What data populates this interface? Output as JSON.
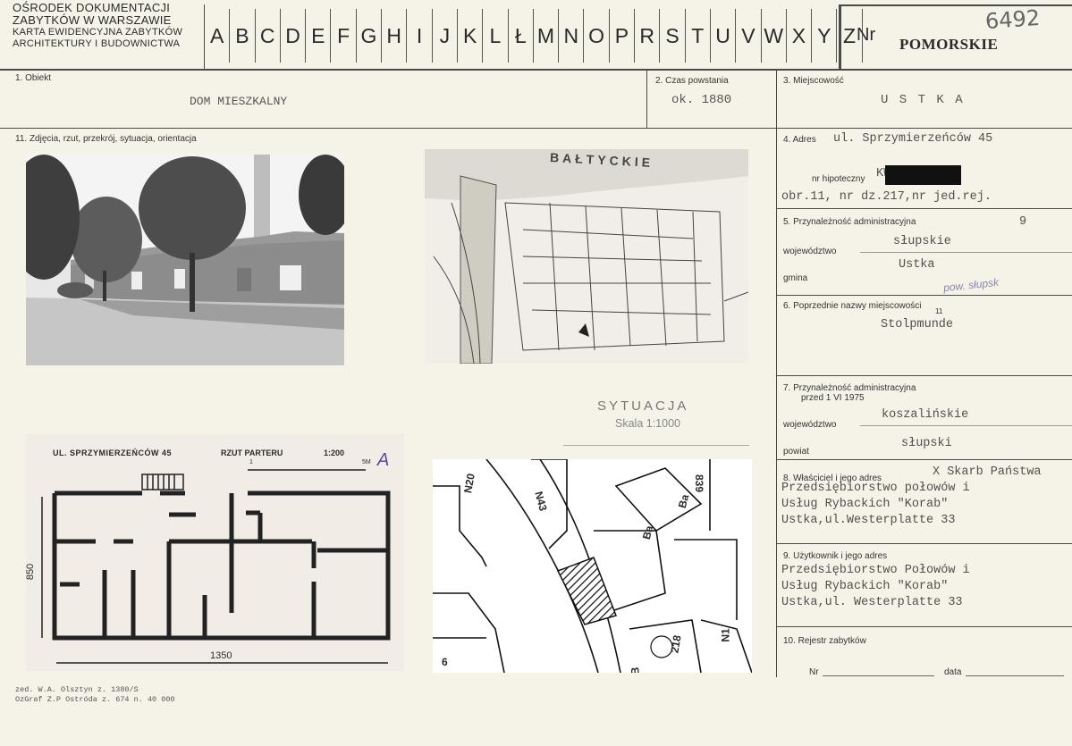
{
  "header": {
    "institution_line1": "Ośrodek Dokumentacji",
    "institution_line2": "Zabytków w Warszawie",
    "institution_line3": "Karta ewidencyjna zabytków",
    "institution_line4": "architektury i budownictwa",
    "letters": [
      "A",
      "B",
      "C",
      "D",
      "E",
      "F",
      "G",
      "H",
      "I",
      "J",
      "K",
      "L",
      "Ł",
      "M",
      "N",
      "O",
      "P",
      "R",
      "S",
      "T",
      "U",
      "V",
      "W",
      "X",
      "Y",
      "Z"
    ],
    "nr_label": "Nr",
    "region": "POMORSKIE",
    "handwritten_number": "6492"
  },
  "fields": {
    "obiekt_label": "1. Obiekt",
    "obiekt_value": "DOM MIESZKALNY",
    "czas_label": "2. Czas powstania",
    "czas_value": "ok. 1880",
    "miejscowosc_label": "3. Miejscowość",
    "miejscowosc_value": "U S T K A",
    "zdjecia_label": "11. Zdjęcia, rzut, przekrój, sytuacja, orientacja",
    "adres_label": "4. Adres",
    "adres_value": "ul. Sprzymierzeńców 45",
    "hipoteczny_label": "nr hipoteczny",
    "hipoteczny_prefix": "KW",
    "hipoteczny_value2": "obr.11, nr dz.217,nr jed.rej.",
    "przynaleznosc_label": "5. Przynależność administracyjna",
    "przynaleznosc_num": "9",
    "wojewodztwo_label": "województwo",
    "wojewodztwo_value": "słupskie",
    "gmina_label": "gmina",
    "gmina_value": "Ustka",
    "gmina_hand": "pow. słupsk",
    "poprzednie_label": "6. Poprzednie nazwy miejscowości",
    "poprzednie_num": "11",
    "poprzednie_value": "Stolpmunde",
    "przynaleznosc_przed_label": "7. Przynależność administracyjna",
    "przed_date": "przed 1 VI 1975",
    "wojewodztwo2_label": "województwo",
    "wojewodztwo2_value": "koszalińskie",
    "powiat_label": "powiat",
    "powiat_value": "słupski",
    "wlasciciel_label": "8. Właściciel i jego adres",
    "wlasciciel_x": "X Skarb Państwa",
    "wlasciciel_l1": "Przedsiębiorstwo połowów i",
    "wlasciciel_l2": "Usług Rybackich \"Korab\"",
    "wlasciciel_l3": "Ustka,ul.Westerplatte 33",
    "uzytkownik_label": "9. Użytkownik i jego adres",
    "uzytkownik_l1": "Przedsiębiorstwo Połowów i",
    "uzytkownik_l2": "Usług Rybackich \"Korab\"",
    "uzytkownik_l3": "Ustka,ul. Westerplatte 33",
    "rejestr_label": "10. Rejestr zabytków",
    "rejestr_nr": "Nr",
    "rejestr_data": "data"
  },
  "situation": {
    "title": "SYTUACJA",
    "scale": "Skala 1:1000"
  },
  "map1": {
    "sea_label": "BAŁTYCKIE"
  },
  "plan": {
    "title": "UL. SPRZYMIERZEŃCÓW 45",
    "subtitle": "RZUT PARTERU",
    "scale": "1:200",
    "mark": "A",
    "dim_vertical": "850",
    "dim_horizontal": "1350",
    "scale_end": "5M",
    "scale_start": "1"
  },
  "map2": {
    "labels": [
      "N20",
      "N43",
      "Ba",
      "Ba",
      "839",
      "N1",
      "218",
      "B",
      "6"
    ]
  },
  "footer": {
    "line1": "zed. W.A. Olsztyn z. 1380/S",
    "line2": "OzGraf Z.P Ostróda z. 674 n. 40 000"
  }
}
